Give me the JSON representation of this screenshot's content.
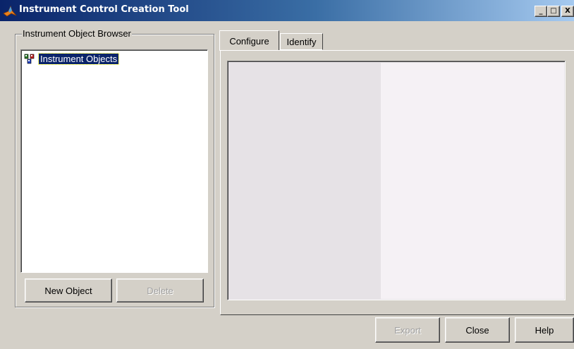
{
  "window": {
    "title": "Instrument Control Creation Tool",
    "minimize_label": "_",
    "maximize_label": "□",
    "close_label": "X"
  },
  "browser": {
    "group_label": "Instrument Object Browser",
    "tree": [
      {
        "label": "Instrument Objects",
        "selected": true
      }
    ],
    "new_object_label": "New Object",
    "delete_label": "Delete"
  },
  "tabs": [
    {
      "label": "Configure",
      "active": true
    },
    {
      "label": "Identify",
      "active": false
    }
  ],
  "footer": {
    "export_label": "Export",
    "close_label": "Close",
    "help_label": "Help"
  },
  "colors": {
    "title_bar_start": "#0a246a",
    "selection": "#0a246a",
    "window_bg": "#d4d0c8"
  }
}
